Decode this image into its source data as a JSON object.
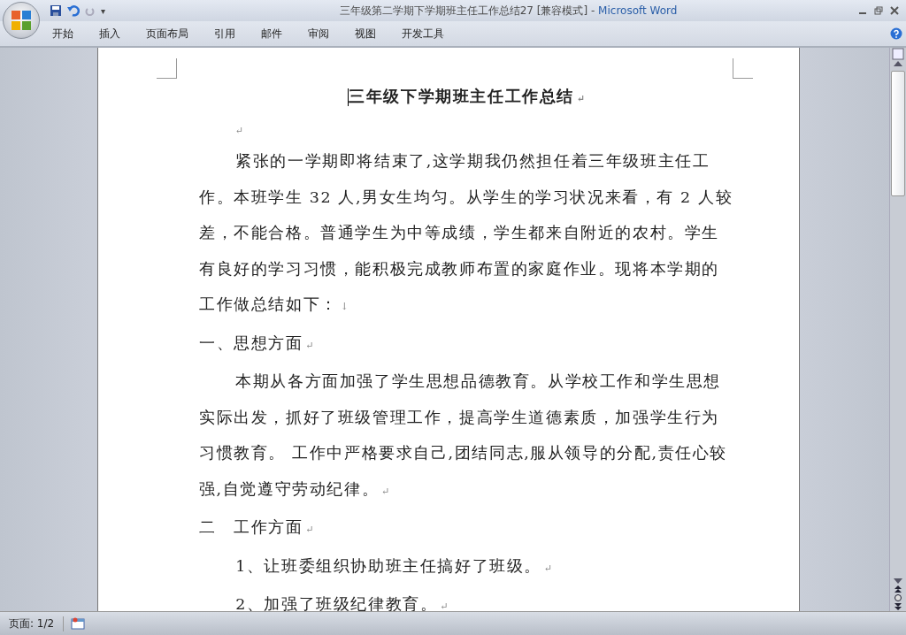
{
  "window": {
    "title": "三年级第二学期下学期班主任工作总结27 [兼容模式]",
    "separator": "-",
    "app": "Microsoft Word"
  },
  "quick_access": {
    "more": "▾"
  },
  "tabs": [
    {
      "label": "开始",
      "selected": false
    },
    {
      "label": "插入",
      "selected": false
    },
    {
      "label": "页面布局",
      "selected": false
    },
    {
      "label": "引用",
      "selected": false
    },
    {
      "label": "邮件",
      "selected": false
    },
    {
      "label": "审阅",
      "selected": false
    },
    {
      "label": "视图",
      "selected": false
    },
    {
      "label": "开发工具",
      "selected": false
    }
  ],
  "document": {
    "paragraphs": [
      {
        "kind": "title",
        "text": "三年级下学期班主任工作总结",
        "mark": "↵"
      },
      {
        "kind": "empty",
        "mark": "↵"
      },
      {
        "kind": "body",
        "text": "紧张的一学期即将结束了,这学期我仍然担任着三年级班主任工作。本班学生 32 人,男女生均匀。从学生的学习状况来看，有 2 人较差，不能合格。普通学生为中等成绩，学生都来自附近的农村。学生有良好的学习习惯，能积极完成教师布置的家庭作业。现将本学期的工作做总结如下：",
        "mark": "↓"
      },
      {
        "kind": "heading",
        "text": "一、思想方面",
        "mark": "↵"
      },
      {
        "kind": "body",
        "text": "本期从各方面加强了学生思想品德教育。从学校工作和学生思想实际出发，抓好了班级管理工作，提高学生道德素质，加强学生行为习惯教育。 工作中严格要求自己,团结同志,服从领导的分配,责任心较强,自觉遵守劳动纪律。",
        "mark": "↵"
      },
      {
        "kind": "heading",
        "text": "二　工作方面",
        "mark": "↵"
      },
      {
        "kind": "body",
        "text": "1、让班委组织协助班主任搞好了班级。",
        "mark": "↵"
      },
      {
        "kind": "body",
        "text": "2、加强了班级纪律教育。",
        "mark": "↵"
      }
    ]
  },
  "status_bar": {
    "page": "页面: 1/2"
  }
}
